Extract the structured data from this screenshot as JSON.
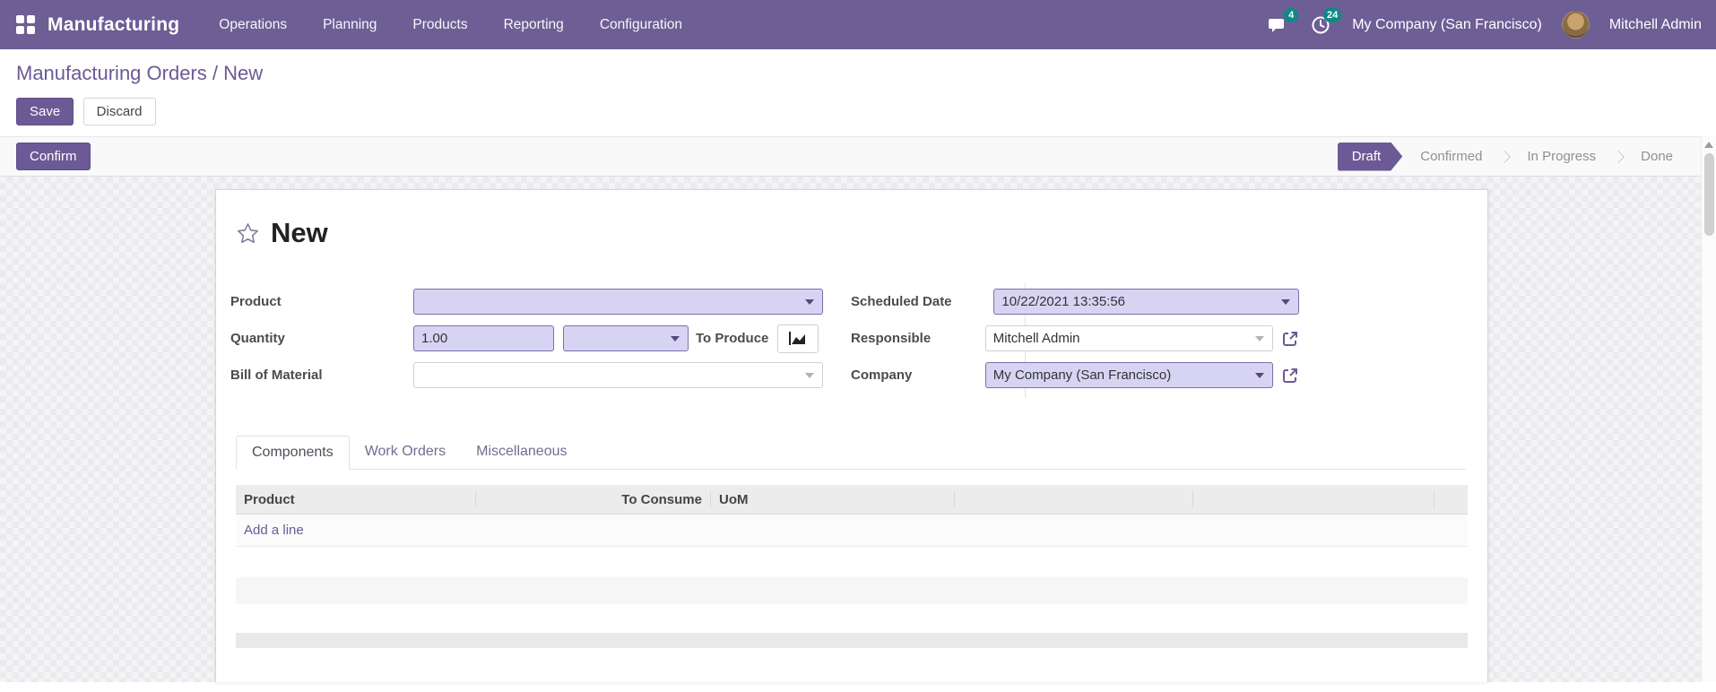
{
  "navbar": {
    "brand": "Manufacturing",
    "menus": [
      "Operations",
      "Planning",
      "Products",
      "Reporting",
      "Configuration"
    ],
    "messages_count": "4",
    "activities_count": "24",
    "company": "My Company (San Francisco)",
    "user": "Mitchell Admin",
    "bg_color": "#6d5e95",
    "badge_color": "#0c8a85"
  },
  "breadcrumb": {
    "path": "Manufacturing Orders",
    "separator": " / ",
    "current": "New"
  },
  "actions": {
    "save": "Save",
    "discard": "Discard",
    "confirm": "Confirm"
  },
  "statusbar": {
    "steps": [
      {
        "label": "Draft",
        "active": true
      },
      {
        "label": "Confirmed",
        "active": false
      },
      {
        "label": "In Progress",
        "active": false
      },
      {
        "label": "Done",
        "active": false
      }
    ]
  },
  "form": {
    "title": "New",
    "fields": {
      "product": {
        "label": "Product",
        "value": ""
      },
      "quantity": {
        "label": "Quantity",
        "value": "1.00",
        "uom_value": "",
        "to_produce_label": "To Produce"
      },
      "bom": {
        "label": "Bill of Material",
        "value": ""
      },
      "scheduled_date": {
        "label": "Scheduled Date",
        "value": "10/22/2021 13:35:56"
      },
      "responsible": {
        "label": "Responsible",
        "value": "Mitchell Admin"
      },
      "company": {
        "label": "Company",
        "value": "My Company (San Francisco)"
      }
    },
    "tabs": [
      {
        "label": "Components",
        "active": true
      },
      {
        "label": "Work Orders",
        "active": false
      },
      {
        "label": "Miscellaneous",
        "active": false
      }
    ],
    "components_table": {
      "headers": {
        "product": "Product",
        "to_consume": "To Consume",
        "uom": "UoM"
      },
      "add_line": "Add a line",
      "rows": []
    }
  },
  "icons": {
    "apps": "grid",
    "messages": "chat-bubbles",
    "activities": "clock",
    "favorite": "star-outline",
    "dropdown": "caret-down",
    "external_link": "arrow-out-of-box",
    "forecast": "area-chart",
    "scrollbar_up": "triangle-up"
  },
  "colors": {
    "accent": "#6b5a95",
    "field_fill": "#d7d4f3",
    "badge": "#0c8a85"
  }
}
